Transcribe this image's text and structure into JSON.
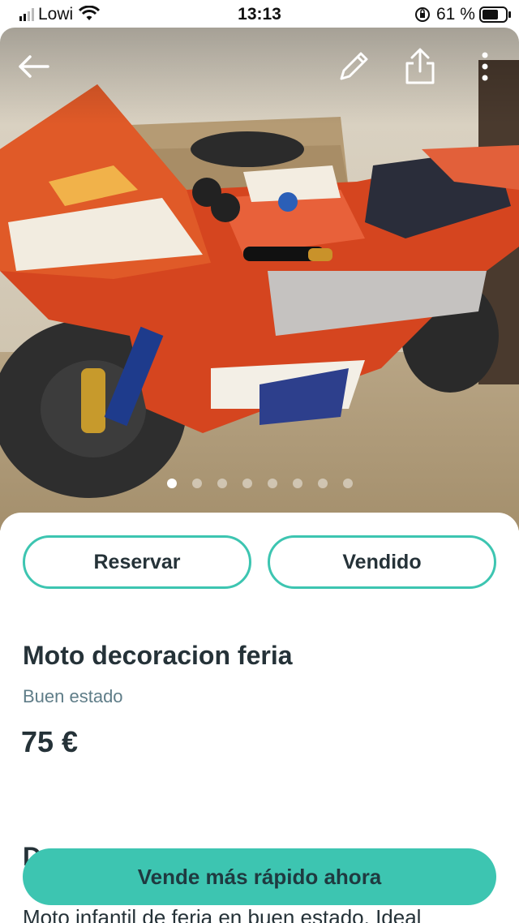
{
  "status_bar": {
    "carrier": "Lowi",
    "time": "13:13",
    "battery": "61 %"
  },
  "hero": {
    "photo_count": 8,
    "active_photo": 1,
    "icons": [
      "back-arrow-icon",
      "edit-pencil-icon",
      "share-icon",
      "more-vertical-icon"
    ]
  },
  "actions": {
    "reserve_label": "Reservar",
    "sold_label": "Vendido"
  },
  "listing": {
    "title": "Moto decoracion feria",
    "condition": "Buen estado",
    "price": "75 €",
    "description_heading_visible": "D",
    "description_visible": "Moto infantil de feria en buen estado. Ideal"
  },
  "cta": {
    "label": "Vende más rápido ahora"
  },
  "colors": {
    "accent": "#3dc5b1",
    "text": "#253238",
    "muted": "#5f7d88"
  }
}
